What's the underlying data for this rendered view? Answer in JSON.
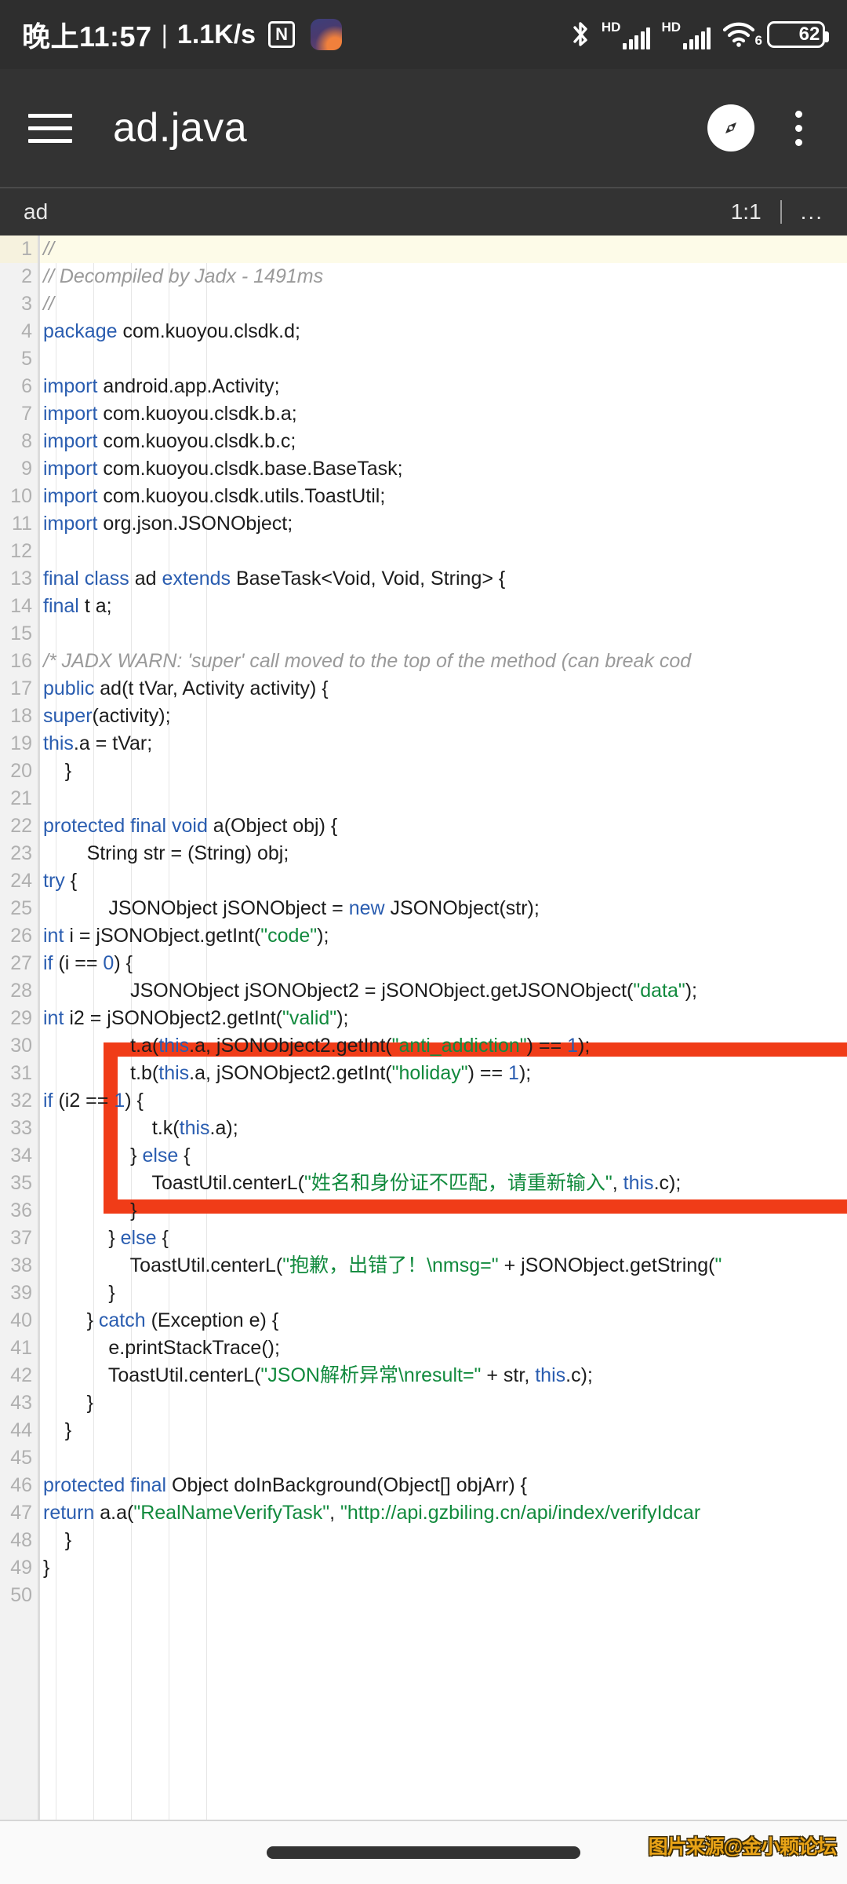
{
  "status_bar": {
    "clock": "晚上11:57",
    "separator": "|",
    "network_speed": "1.1K/s",
    "nfc_glyph": "N",
    "icons": [
      "bluetooth-icon",
      "nfc-icon",
      "notification-app-icon",
      "signal-hd-1-icon",
      "signal-hd-2-icon",
      "wifi-6-icon",
      "battery-icon"
    ],
    "hd_label_1": "HD",
    "hd_label_2": "HD",
    "wifi_generation": "6",
    "battery_percent": "62"
  },
  "app_bar": {
    "menu_icon": "hamburger-menu-icon",
    "title": "ad.java",
    "action_icon": "compass-navigate-icon",
    "overflow_icon": "kebab-overflow-icon"
  },
  "info_bar": {
    "tab_name": "ad",
    "cursor_position": "1:1",
    "more": "..."
  },
  "editor": {
    "highlighted_line": 1,
    "total_lines": 50,
    "colors": {
      "keyword": "#2a5db0",
      "string": "#118a3d",
      "comment": "#9a9a9a",
      "text": "#1c1c1c",
      "gutter_bg": "#f2f2f2",
      "highlight_row": "#fdfbe8",
      "annotation_red": "#f03c18"
    },
    "lines": [
      {
        "n": 1,
        "html": "<span class='cmt'>//</span>"
      },
      {
        "n": 2,
        "html": "<span class='cmt'>// Decompiled by Jadx - 1491ms</span>"
      },
      {
        "n": 3,
        "html": "<span class='cmt'>//</span>"
      },
      {
        "n": 4,
        "html": "<span class='kw'>package</span> com.kuoyou.clsdk.d;"
      },
      {
        "n": 5,
        "html": ""
      },
      {
        "n": 6,
        "html": "<span class='kw'>import</span> android.app.Activity;"
      },
      {
        "n": 7,
        "html": "<span class='kw'>import</span> com.kuoyou.clsdk.b.a;"
      },
      {
        "n": 8,
        "html": "<span class='kw'>import</span> com.kuoyou.clsdk.b.c;"
      },
      {
        "n": 9,
        "html": "<span class='kw'>import</span> com.kuoyou.clsdk.base.BaseTask;"
      },
      {
        "n": 10,
        "html": "<span class='kw'>import</span> com.kuoyou.clsdk.utils.ToastUtil;"
      },
      {
        "n": 11,
        "html": "<span class='kw'>import</span> org.json.JSONObject;"
      },
      {
        "n": 12,
        "html": ""
      },
      {
        "n": 13,
        "html": "<span class='kw'>final class</span> ad <span class='kw'>extends</span> BaseTask&lt;Void, Void, String&gt; {"
      },
      {
        "n": 14,
        "html": "    <span class='kw'>final</span> t a;"
      },
      {
        "n": 15,
        "html": ""
      },
      {
        "n": 16,
        "html": "    <span class='cmt'>/* JADX WARN: 'super' call moved to the top of the method (can break cod</span>"
      },
      {
        "n": 17,
        "html": "    <span class='kw'>public</span> ad(t tVar, Activity activity) {"
      },
      {
        "n": 18,
        "html": "        <span class='kw'>super</span>(activity);"
      },
      {
        "n": 19,
        "html": "        <span class='ths'>this</span>.a = tVar;"
      },
      {
        "n": 20,
        "html": "    }"
      },
      {
        "n": 21,
        "html": ""
      },
      {
        "n": 22,
        "html": "    <span class='kw'>protected final void</span> a(Object obj) {"
      },
      {
        "n": 23,
        "html": "        String str = (String) obj;"
      },
      {
        "n": 24,
        "html": "        <span class='kw'>try</span> {"
      },
      {
        "n": 25,
        "html": "            JSONObject jSONObject = <span class='kw'>new</span> JSONObject(str);"
      },
      {
        "n": 26,
        "html": "            <span class='kw'>int</span> i = jSONObject.getInt(<span class='str'>\"code\"</span>);"
      },
      {
        "n": 27,
        "html": "            <span class='kw'>if</span> (i == <span class='num'>0</span>) {"
      },
      {
        "n": 28,
        "html": "                JSONObject jSONObject2 = jSONObject.getJSONObject(<span class='str'>\"data\"</span>);"
      },
      {
        "n": 29,
        "html": "                <span class='kw'>int</span> i2 = jSONObject2.getInt(<span class='str'>\"valid\"</span>);"
      },
      {
        "n": 30,
        "html": "                t.a(<span class='ths'>this</span>.a, jSONObject2.getInt(<span class='str'>\"anti_addiction\"</span>) == <span class='num'>1</span>);"
      },
      {
        "n": 31,
        "html": "                t.b(<span class='ths'>this</span>.a, jSONObject2.getInt(<span class='str'>\"holiday\"</span>) == <span class='num'>1</span>);"
      },
      {
        "n": 32,
        "html": "                <span class='kw'>if</span> (i2 == <span class='num'>1</span>) {"
      },
      {
        "n": 33,
        "html": "                    t.k(<span class='ths'>this</span>.a);"
      },
      {
        "n": 34,
        "html": "                } <span class='kw'>else</span> {"
      },
      {
        "n": 35,
        "html": "                    ToastUtil.centerL(<span class='str'>\"姓名和身份证不匹配，请重新输入\"</span>, <span class='ths'>this</span>.c);"
      },
      {
        "n": 36,
        "html": "                }"
      },
      {
        "n": 37,
        "html": "            } <span class='kw'>else</span> {"
      },
      {
        "n": 38,
        "html": "                ToastUtil.centerL(<span class='str'>\"抱歉，出错了！\\nmsg=\"</span> + jSONObject.getString(<span class='str'>\"</span>"
      },
      {
        "n": 39,
        "html": "            }"
      },
      {
        "n": 40,
        "html": "        } <span class='kw'>catch</span> (Exception e) {"
      },
      {
        "n": 41,
        "html": "            e.printStackTrace();"
      },
      {
        "n": 42,
        "html": "            ToastUtil.centerL(<span class='str'>\"JSON解析异常\\nresult=\"</span> + str, <span class='ths'>this</span>.c);"
      },
      {
        "n": 43,
        "html": "        }"
      },
      {
        "n": 44,
        "html": "    }"
      },
      {
        "n": 45,
        "html": ""
      },
      {
        "n": 46,
        "html": "    <span class='kw'>protected final</span> Object doInBackground(Object[] objArr) {"
      },
      {
        "n": 47,
        "html": "        <span class='kw'>return</span> a.a(<span class='str'>\"RealNameVerifyTask\"</span>, <span class='str'>\"http://api.gzbiling.cn/api/index/verifyIdcar</span>"
      },
      {
        "n": 48,
        "html": "    }"
      },
      {
        "n": 49,
        "html": "}"
      },
      {
        "n": 50,
        "html": ""
      }
    ]
  },
  "annotation": {
    "type": "red-rectangle-highlight",
    "covers_lines": "31-37"
  },
  "bottom": {
    "watermark": "图片来源@金小颗论坛",
    "nav_pill": "gesture-nav-pill"
  }
}
